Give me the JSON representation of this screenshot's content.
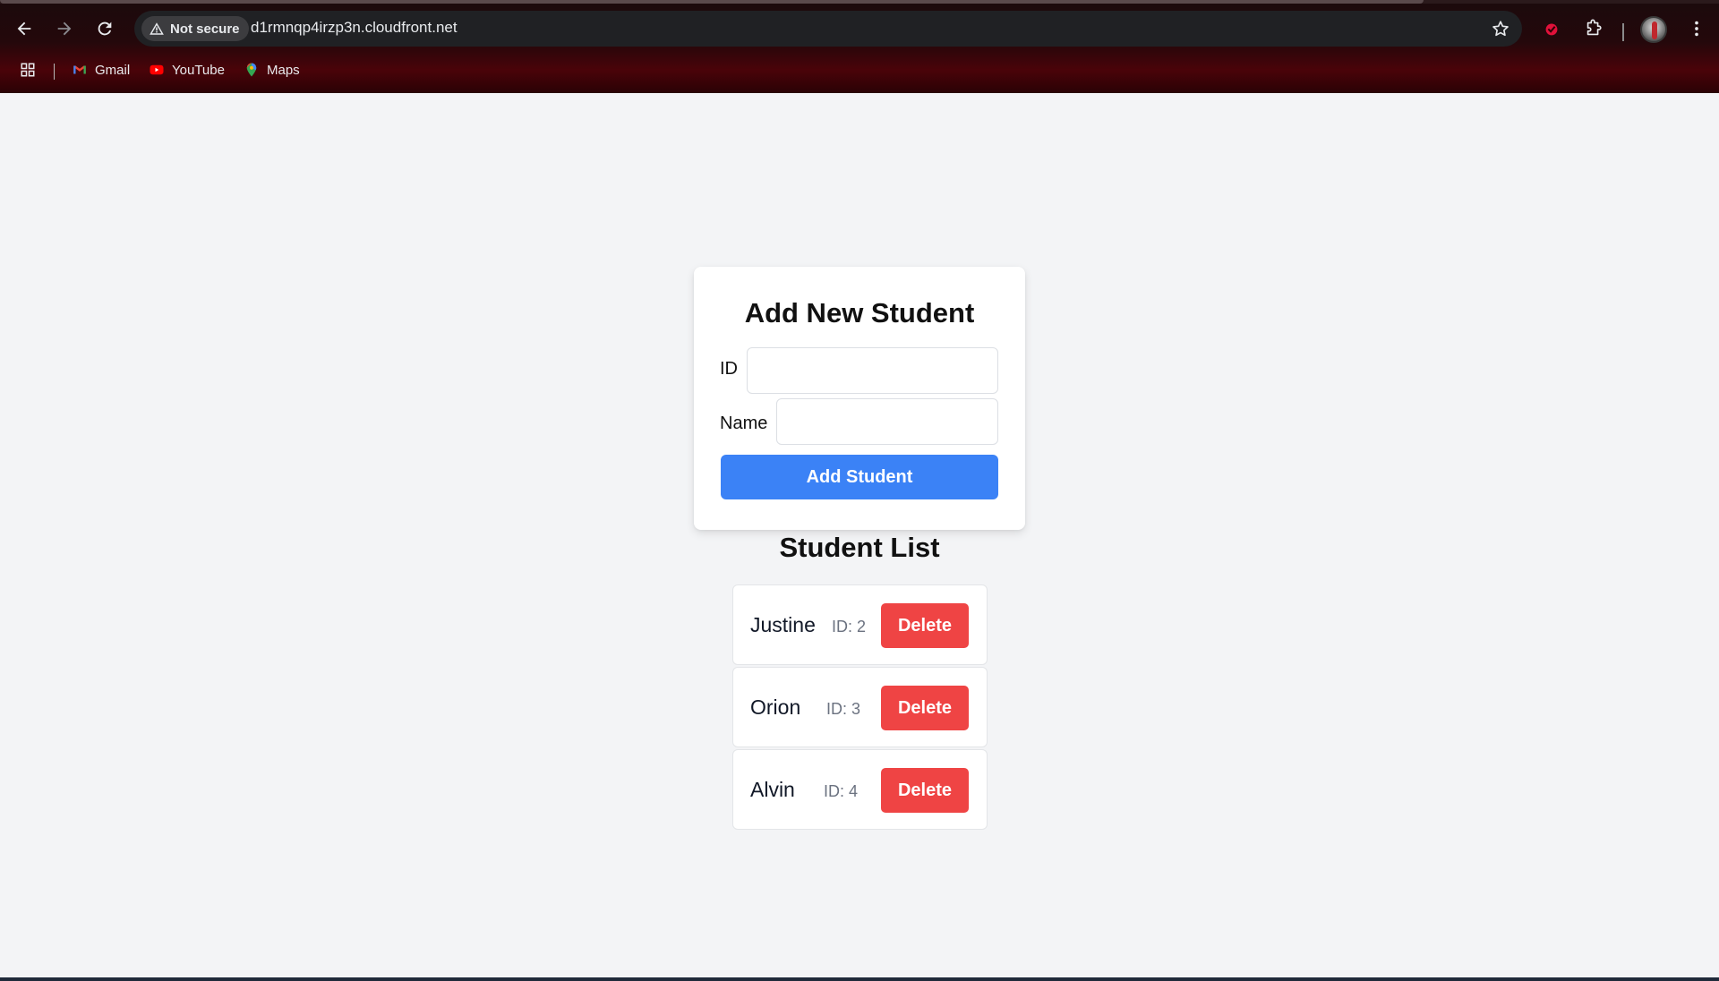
{
  "browser": {
    "security_label": "Not secure",
    "url": "d1rmnqp4irzp3n.cloudfront.net",
    "bookmarks": [
      {
        "label": "Gmail",
        "icon": "gmail-icon"
      },
      {
        "label": "YouTube",
        "icon": "youtube-icon"
      },
      {
        "label": "Maps",
        "icon": "maps-icon"
      }
    ]
  },
  "form": {
    "title": "Add New Student",
    "id_label": "ID",
    "id_value": "",
    "name_label": "Name",
    "name_value": "",
    "submit_label": "Add Student"
  },
  "list": {
    "title": "Student List",
    "students": [
      {
        "name": "Justine",
        "id_text": "ID: 2",
        "action": "Delete"
      },
      {
        "name": "Orion",
        "id_text": "ID: 3",
        "action": "Delete"
      },
      {
        "name": "Alvin",
        "id_text": "ID: 4",
        "action": "Delete"
      }
    ]
  },
  "colors": {
    "primary": "#3b82f6",
    "danger": "#ef4444",
    "page_bg": "#f3f4f6"
  }
}
